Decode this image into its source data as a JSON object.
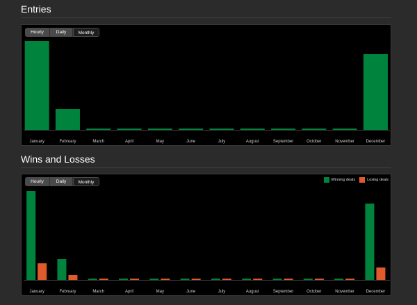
{
  "entries_section": {
    "title": "Entries",
    "range_buttons": [
      "Hourly",
      "Daily",
      "Monthly"
    ],
    "active_range": "Monthly",
    "chart_data": {
      "type": "bar",
      "categories": [
        "January",
        "February",
        "March",
        "April",
        "May",
        "June",
        "July",
        "August",
        "September",
        "October",
        "November",
        "December"
      ],
      "series": [
        {
          "values": [
            128,
            30,
            2,
            2,
            2,
            2,
            2,
            2,
            2,
            2,
            2,
            109
          ],
          "color": "#00843d"
        }
      ],
      "grid": false
    }
  },
  "wins_losses_section": {
    "title": "Wins and Losses",
    "range_buttons": [
      "Hourly",
      "Daily",
      "Monthly"
    ],
    "active_range": "Monthly",
    "legend": {
      "winning": "Winning deals",
      "losing": "Losing deals"
    },
    "chart_data": {
      "type": "bar",
      "categories": [
        "January",
        "February",
        "March",
        "April",
        "May",
        "June",
        "July",
        "August",
        "September",
        "October",
        "November",
        "December"
      ],
      "series": [
        {
          "name": "Winning deals",
          "values": [
            128,
            30,
            2,
            2,
            2,
            2,
            2,
            2,
            2,
            2,
            2,
            110
          ],
          "color": "#00843d"
        },
        {
          "name": "Losing deals",
          "values": [
            24,
            7,
            2,
            2,
            2,
            2,
            2,
            2,
            2,
            2,
            2,
            18
          ],
          "color": "#e05a2b"
        }
      ],
      "legend_position": "top-right",
      "grid": false
    }
  }
}
